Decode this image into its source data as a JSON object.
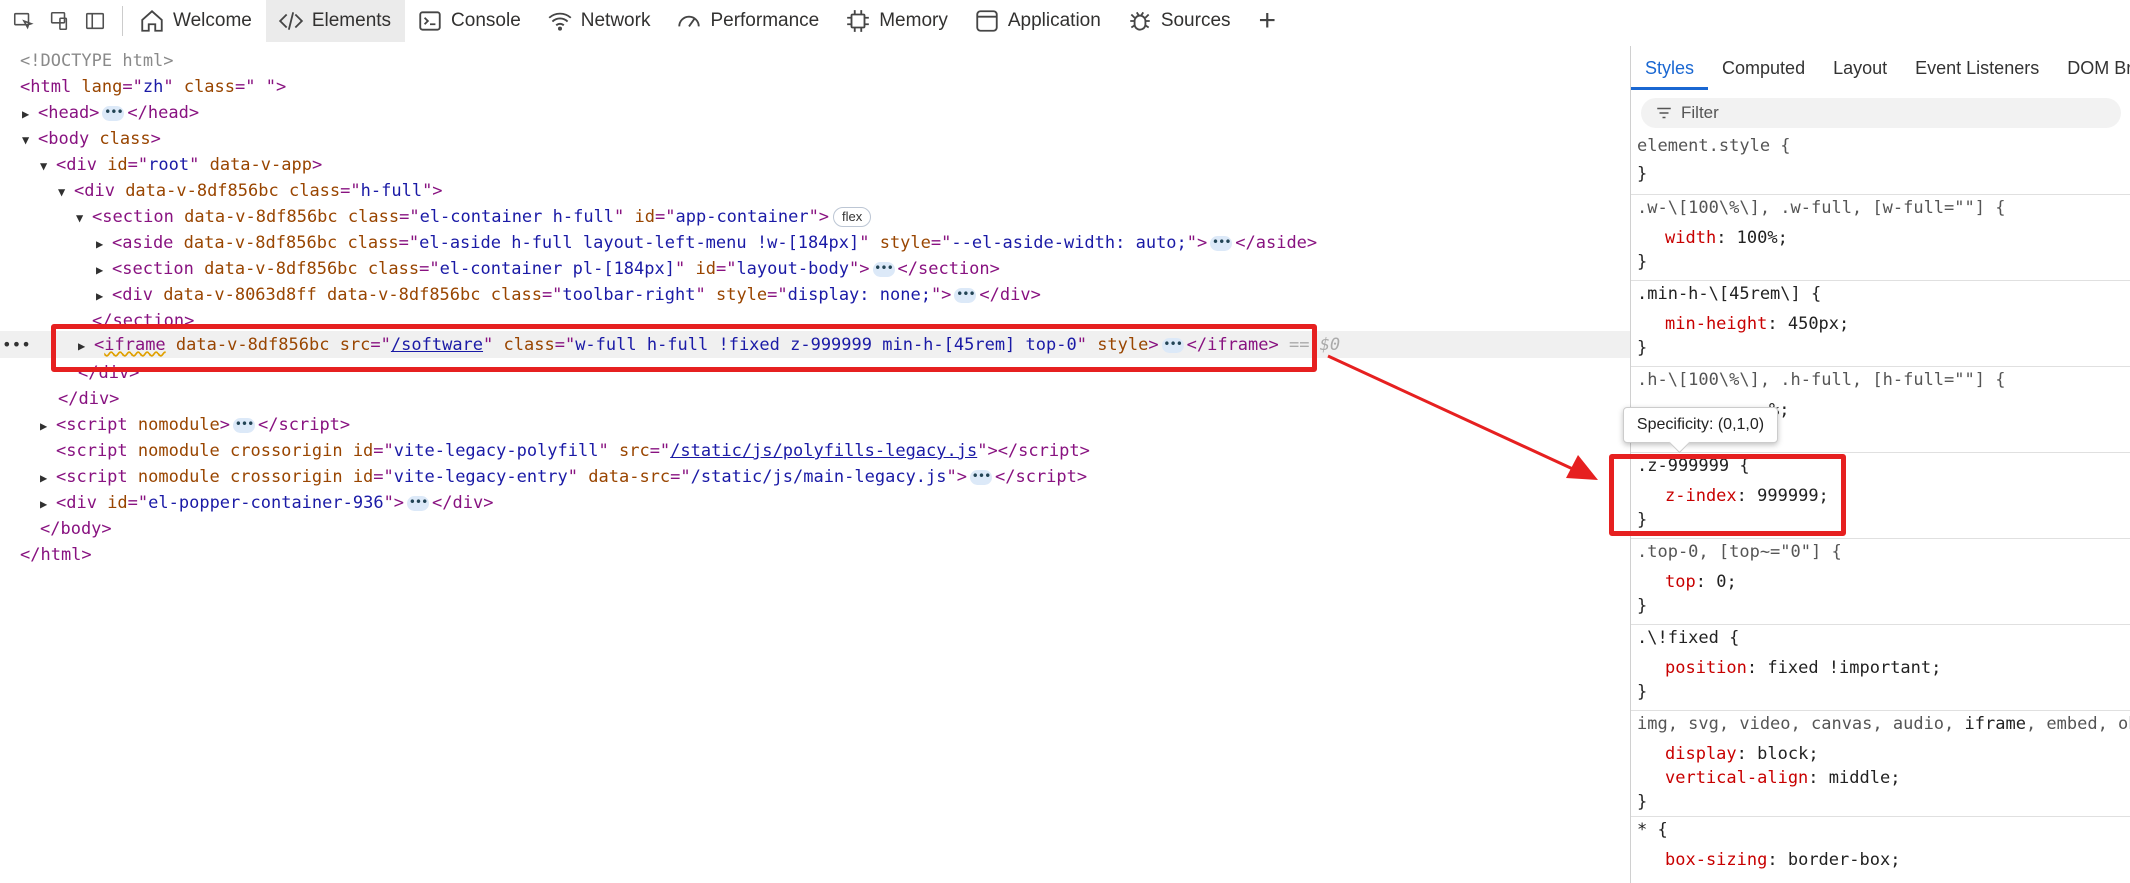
{
  "toolbar": {
    "tabs": [
      {
        "label": "Welcome",
        "icon": "home-icon"
      },
      {
        "label": "Elements",
        "icon": "code-icon"
      },
      {
        "label": "Console",
        "icon": "console-icon"
      },
      {
        "label": "Network",
        "icon": "wifi-icon"
      },
      {
        "label": "Performance",
        "icon": "gauge-icon"
      },
      {
        "label": "Memory",
        "icon": "chip-icon"
      },
      {
        "label": "Application",
        "icon": "window-icon"
      },
      {
        "label": "Sources",
        "icon": "bug-icon"
      }
    ],
    "add_tab": "+"
  },
  "dom": {
    "doctype": "<!DOCTYPE html>",
    "html_lang": "zh",
    "html_class": " ",
    "v_8df": "data-v-8df856bc",
    "v_806": "data-v-8063d8ff",
    "root_id": "root",
    "app_attr": "data-v-app",
    "hfull": "h-full",
    "section_class": "el-container h-full",
    "section_id": "app-container",
    "flex_badge": "flex",
    "aside_class": "el-aside h-full layout-left-menu !w-[184px]",
    "aside_style": "--el-aside-width: auto;",
    "body_section_class": "el-container pl-[184px]",
    "body_section_id": "layout-body",
    "toolbar_class": "toolbar-right",
    "toolbar_style": "display: none;",
    "iframe_src": "/software",
    "iframe_class": "w-full h-full !fixed z-999999 min-h-[45rem] top-0",
    "iframe_marker": "== $0",
    "polyfill_id": "vite-legacy-polyfill",
    "polyfill_src": "/static/js/polyfills-legacy.js",
    "entry_id": "vite-legacy-entry",
    "entry_src": "/static/js/main-legacy.js",
    "popper_id": "el-popper-container-936"
  },
  "styles": {
    "tabs": [
      "Styles",
      "Computed",
      "Layout",
      "Event Listeners",
      "DOM Bre"
    ],
    "filter_placeholder": "Filter",
    "tooltip": "Specificity: (0,1,0)",
    "rules": {
      "element": "element.style {",
      "w_sel": ".w-\\[100\\%\\], .w-full, [w-full=\"\"] {",
      "w_prop": "width",
      "w_val": "100%;",
      "minh_sel": ".min-h-\\[45rem\\] {",
      "minh_prop": "min-height",
      "minh_val": "450px;",
      "h_sel": ".h-\\[100\\%\\], .h-full, [h-full=\"\"] {",
      "h_tail": "%;",
      "z_sel": ".z-999999 {",
      "z_prop": "z-index",
      "z_val": "999999;",
      "top_sel": ".top-0, [top~=\"0\"] {",
      "top_prop": "top",
      "top_val": "0;",
      "fixed_sel": ".\\!fixed {",
      "fixed_prop": "position",
      "fixed_val": "fixed !important;",
      "media_sel_a": "img, svg, video, canvas, audio, ",
      "media_sel_b": "iframe",
      "media_sel_c": ", embed, obj",
      "display_prop": "display",
      "display_val": "block;",
      "va_prop": "vertical-align",
      "va_val": "middle;",
      "star_sel": "* {",
      "bs_prop": "box-sizing",
      "bs_val": "border-box;",
      "close": "}"
    }
  },
  "colors": {
    "highlight": "#e62020",
    "tag": "#881280",
    "attr": "#994500",
    "value": "#1a1aa6",
    "active_tab": "#1967d2"
  }
}
